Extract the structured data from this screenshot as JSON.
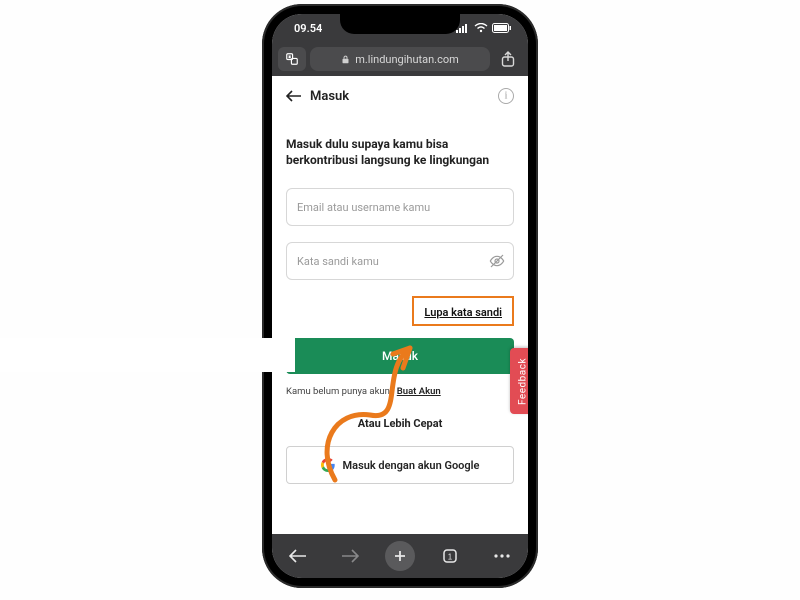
{
  "statusbar": {
    "time": "09.54"
  },
  "urlbar": {
    "url": "m.lindungihutan.com"
  },
  "header": {
    "title": "Masuk"
  },
  "form": {
    "prompt": "Masuk dulu supaya kamu bisa berkontribusi langsung ke lingkungan",
    "email_placeholder": "Email atau username kamu",
    "password_placeholder": "Kata sandi kamu",
    "forgot_label": "Lupa kata sandi",
    "submit_label": "Masuk",
    "create_prefix": "Kamu belum punya akun? ",
    "create_link": "Buat Akun",
    "or_faster": "Atau Lebih Cepat",
    "google_label": "Masuk dengan akun Google"
  },
  "feedback": {
    "label": "Feedback"
  }
}
